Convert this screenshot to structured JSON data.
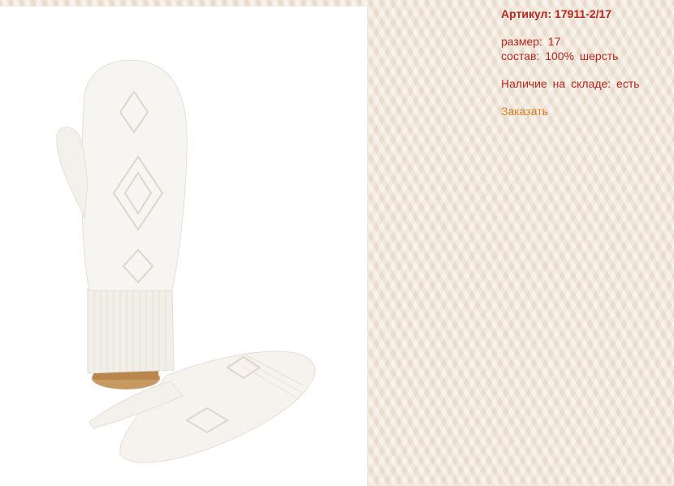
{
  "product": {
    "article_label": "Артикул: 17911-2/17",
    "size_line": "размер:  17",
    "composition_line": "состав:  100%  шерсть",
    "stock_line": "Наличие  на  складе:  есть",
    "order_label": "Заказать"
  },
  "colors": {
    "text_red": "#b8261e",
    "link_orange": "#dd7a1c",
    "background_knit": "#f1e6d9",
    "photo_background": "#ffffff",
    "mitten_white": "#f7f5f1"
  }
}
